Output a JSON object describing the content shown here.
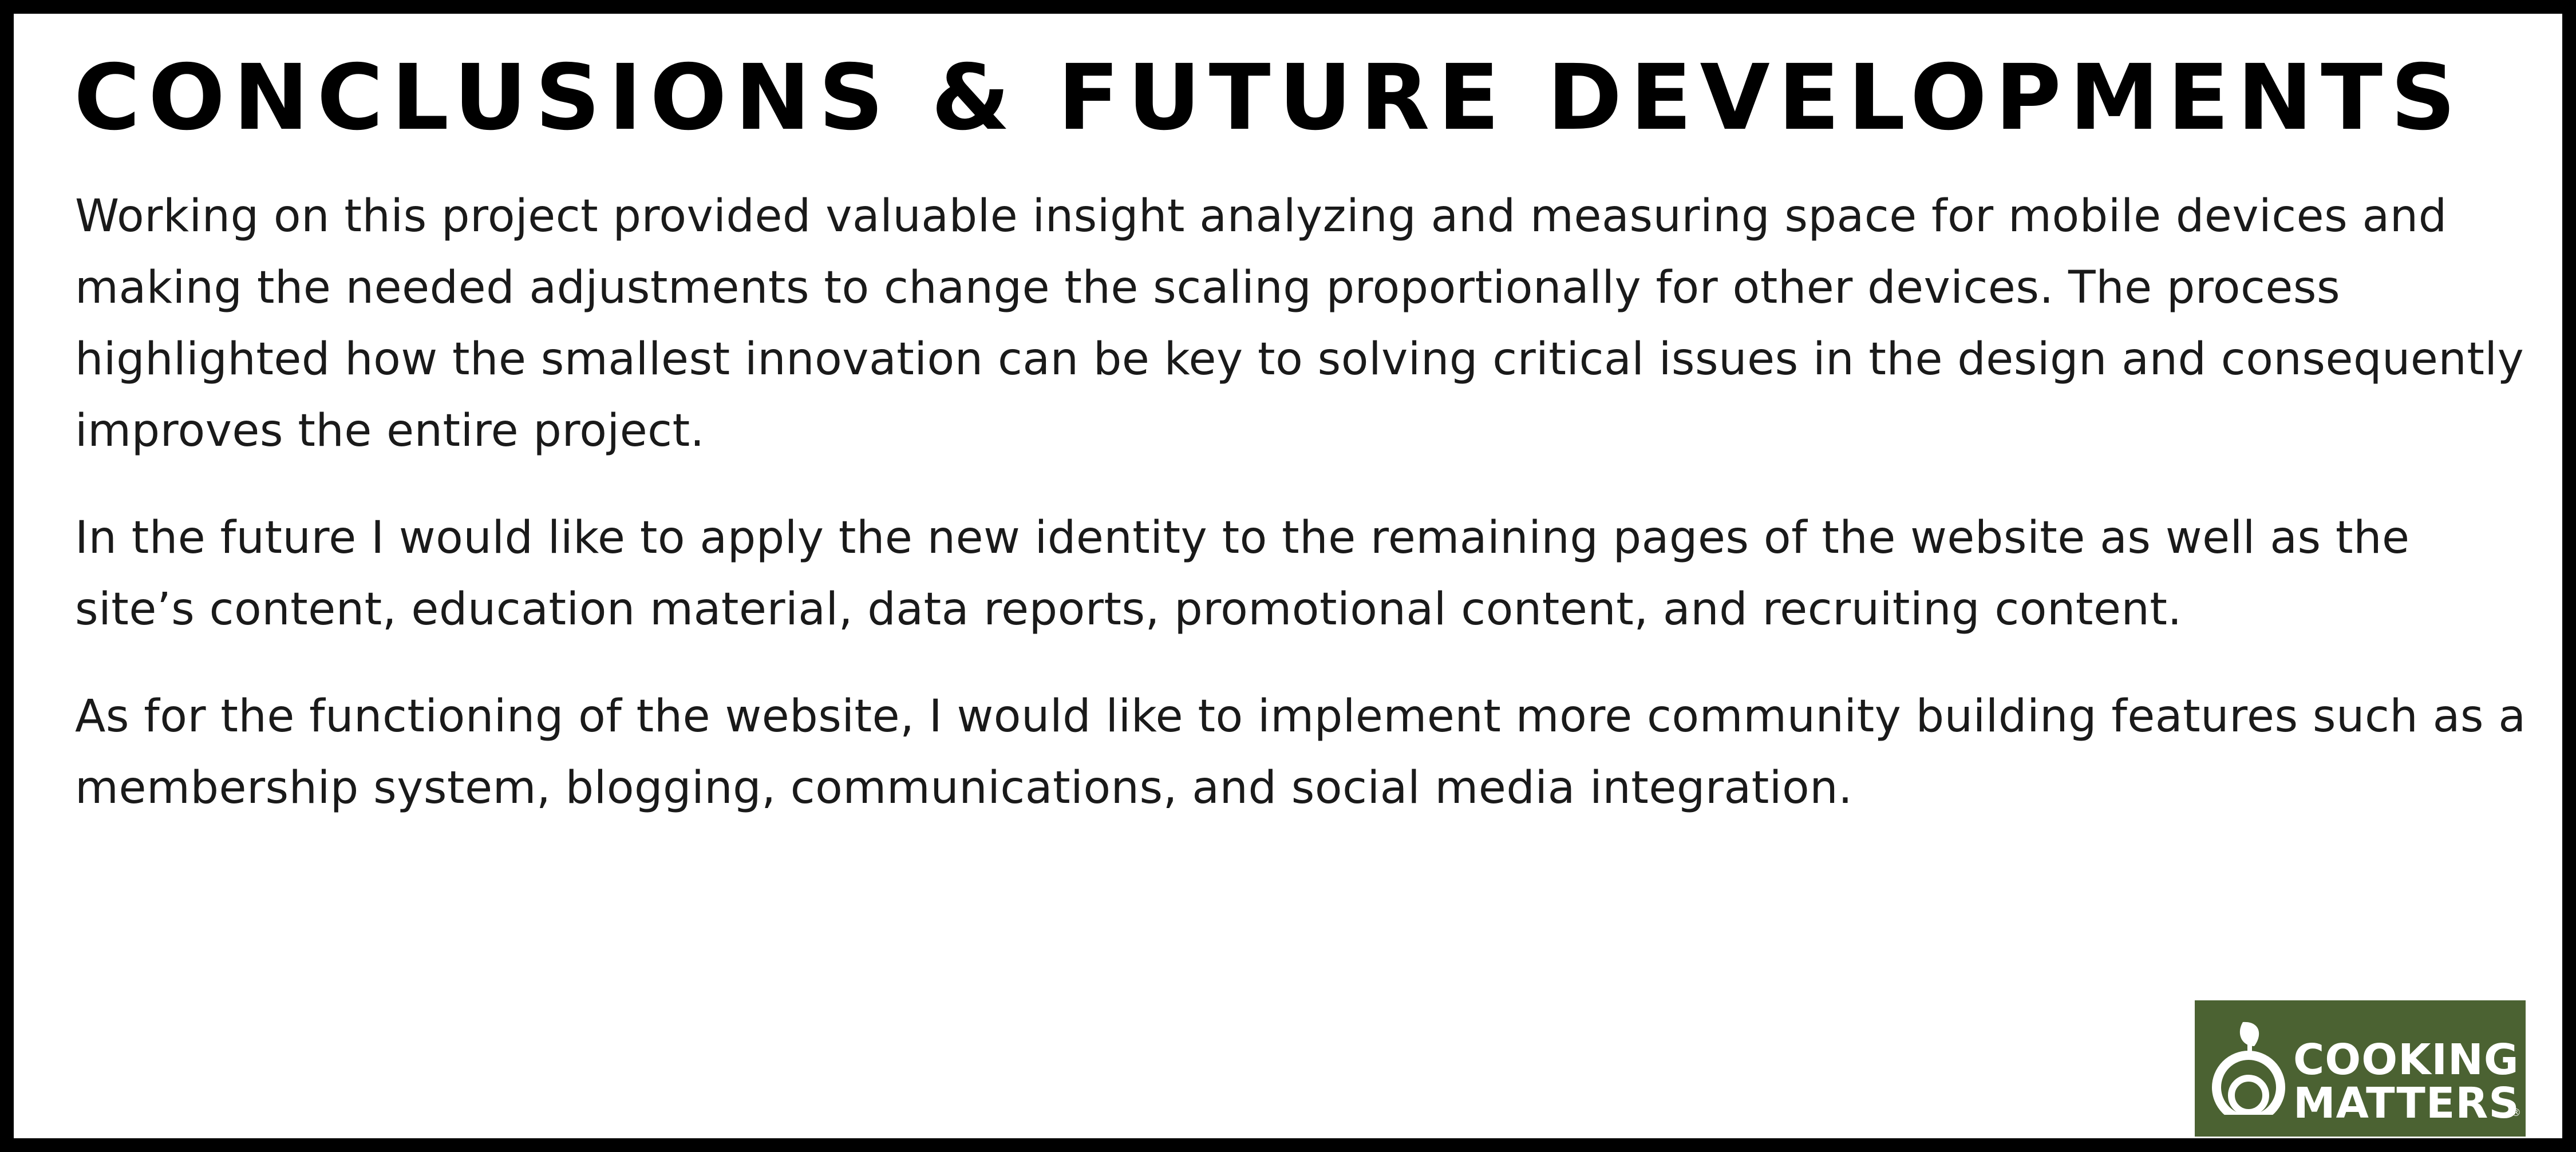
{
  "slide": {
    "title": "CONCLUSIONS & FUTURE DEVELOPMENTS",
    "paragraphs": [
      "Working on this project provided valuable insight analyzing and measuring space for mobile devices and making the needed adjustments to change the scaling proportionally for other devices. The process highlighted how the smallest innovation can be key to solving critical issues in the design and consequently improves the entire project.",
      "In the future I would like to apply the new identity to the remaining pages of the website as well as the site’s content, education material, data reports, promotional content, and recruiting content.",
      "As for the functioning of the website, I would like to implement more community building features such as a membership system, blogging, communications, and social media integration."
    ]
  },
  "logo": {
    "line1": "COOKING",
    "line2": "MATTERS",
    "mark": "®",
    "icon": "apple-leaf-icon",
    "background_color": "#4b6232",
    "text_color": "#ffffff"
  },
  "colors": {
    "border": "#000000",
    "text": "#000000"
  }
}
